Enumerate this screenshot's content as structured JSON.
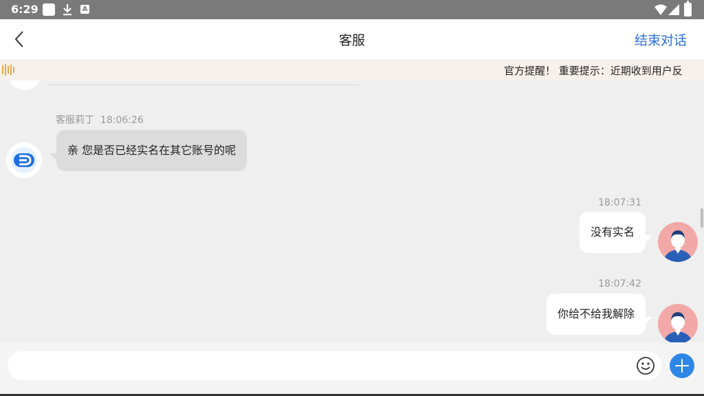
{
  "status_bar": {
    "time": "6:29",
    "notification_icons": [
      "square-notification-icon",
      "download-icon",
      "a-badge-icon"
    ],
    "system_icons": [
      "wifi-icon",
      "signal-icon",
      "battery-icon"
    ]
  },
  "header": {
    "back_icon": "chevron-left-icon",
    "title": "客服",
    "end_chat_label": "结束对话"
  },
  "notice": {
    "icon": "sound-wave-icon",
    "text": "官方提醒！ 重要提示：近期收到用户反"
  },
  "messages": [
    {
      "sender": "agent",
      "name": "客服莉丁",
      "time": "18:06:26",
      "text": "亲 您是否已经实名在其它账号的呢"
    },
    {
      "sender": "user",
      "time": "18:07:31",
      "text": "没有实名"
    },
    {
      "sender": "user",
      "time": "18:07:42",
      "text": "你给不给我解除"
    }
  ],
  "input": {
    "placeholder": "",
    "value": "",
    "emoji_icon": "smiley-icon",
    "add_icon": "plus-icon"
  },
  "colors": {
    "accent": "#2c6fd6",
    "plus_button": "#2e86e6",
    "notice_bg": "#f7f1ec",
    "chat_bg": "#efefef",
    "agent_bubble": "#dcdcdc",
    "user_bubble": "#ffffff",
    "user_avatar_bg": "#f3a8a8"
  }
}
